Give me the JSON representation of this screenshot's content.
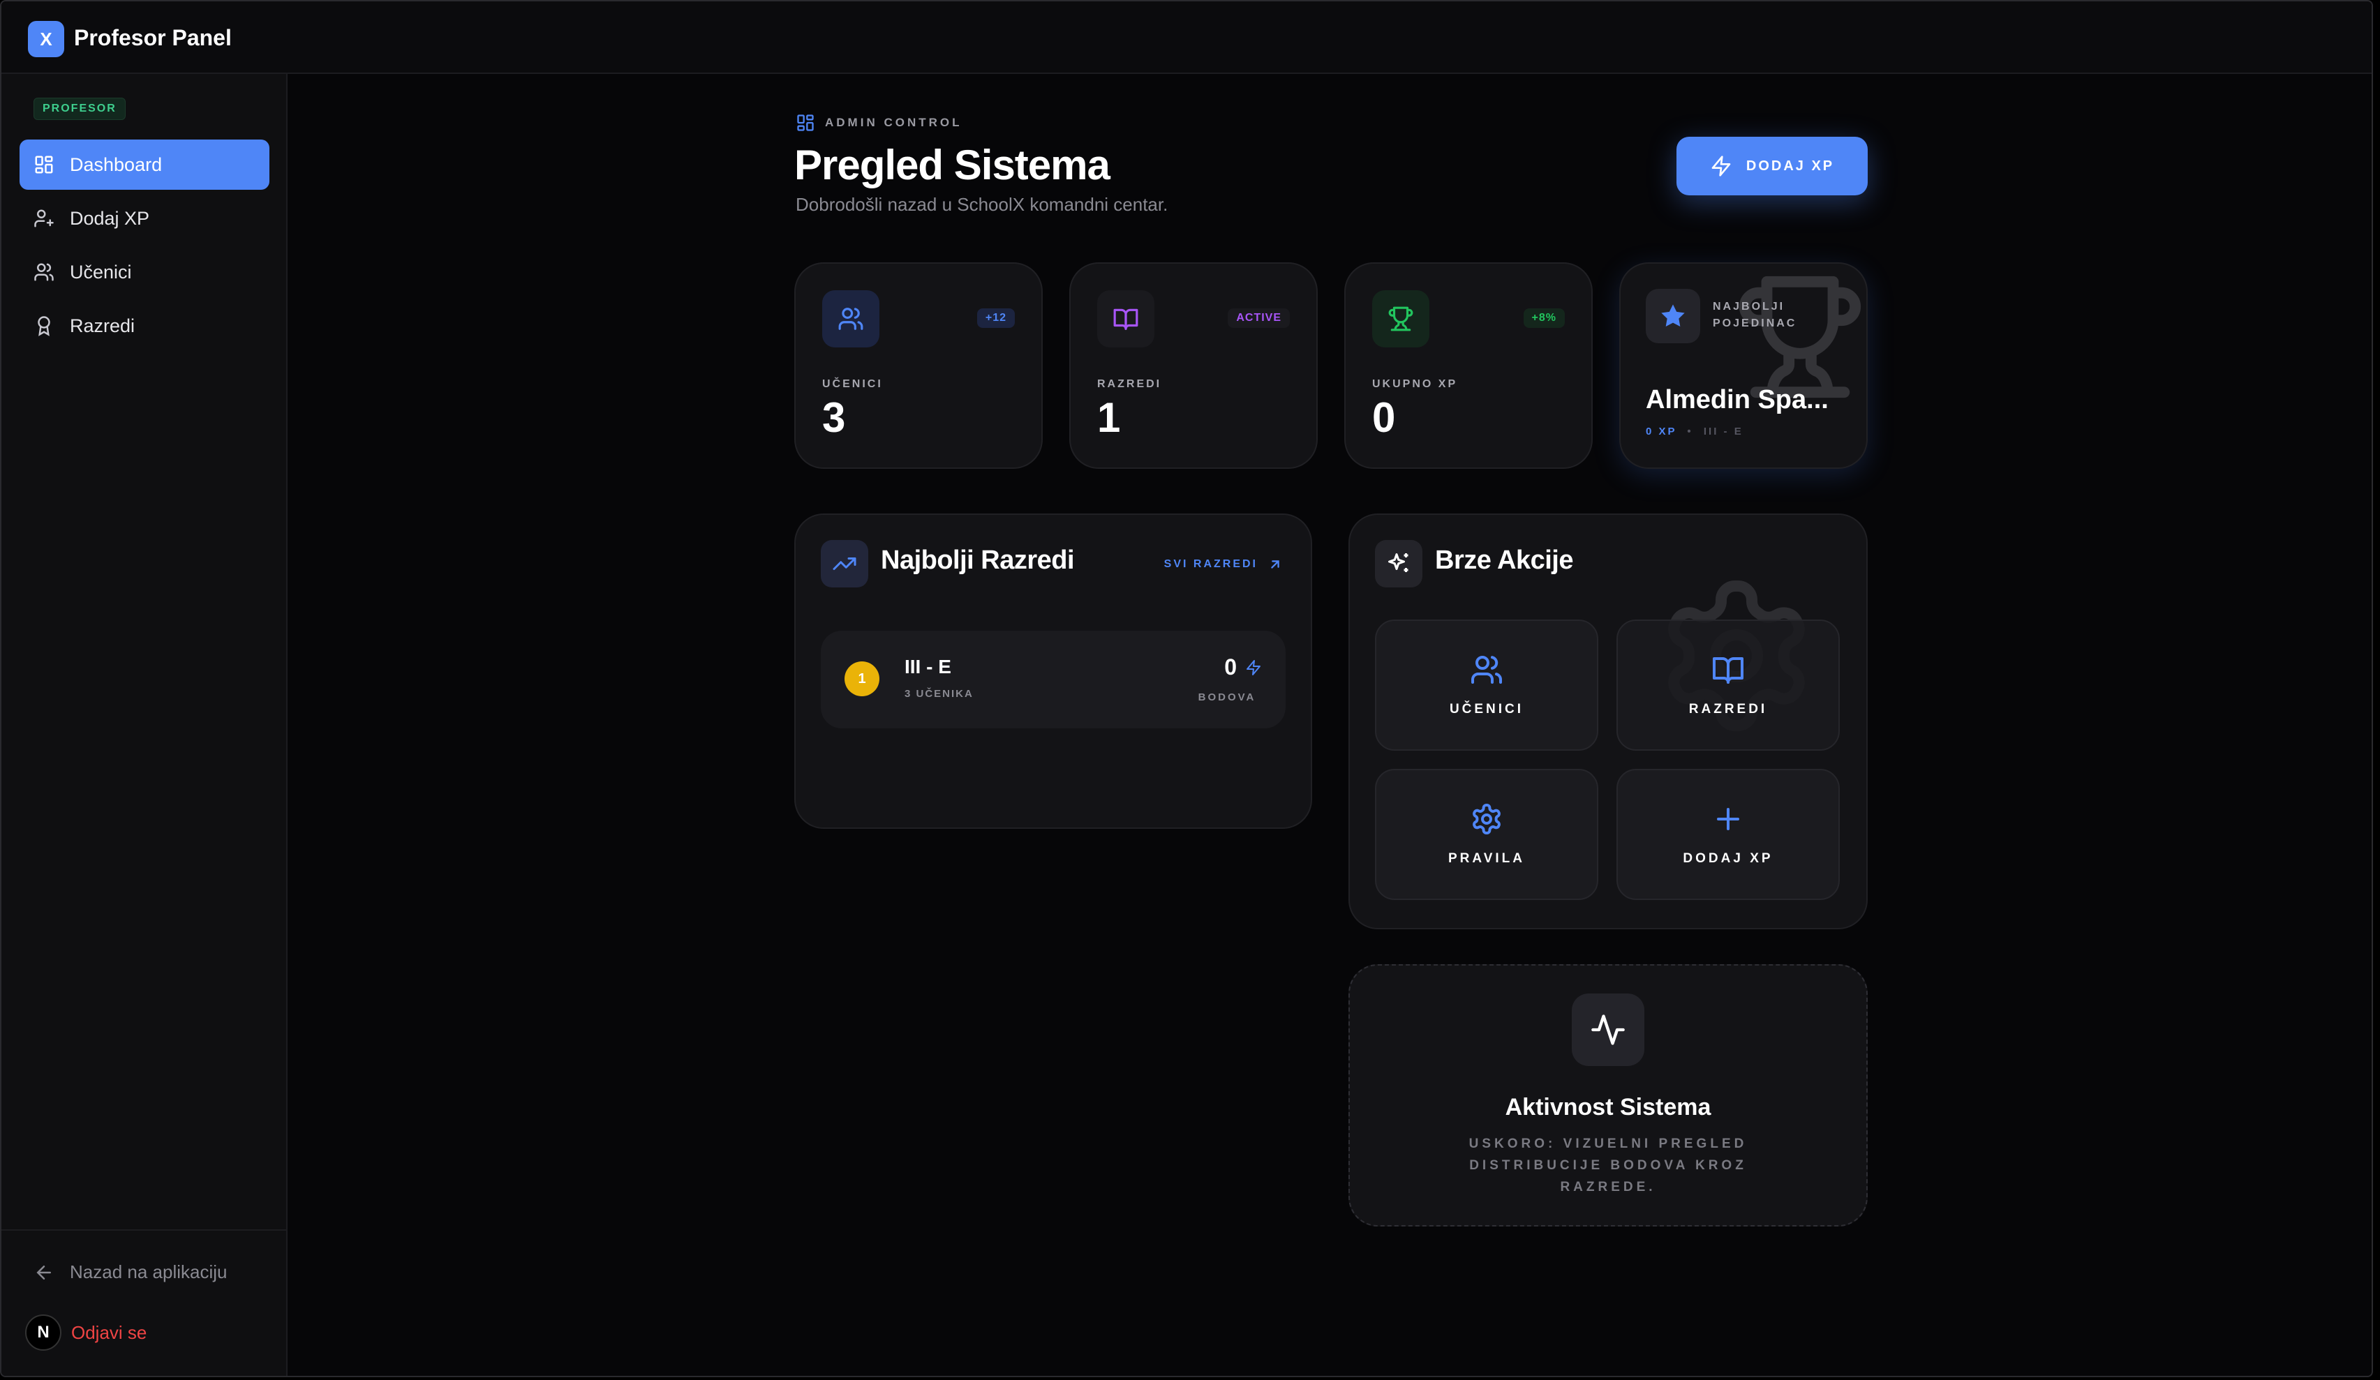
{
  "app": {
    "logo_letter": "X",
    "title": "Profesor Panel"
  },
  "sidebar": {
    "role": "PROFESOR",
    "items": [
      {
        "label": "Dashboard",
        "icon": "dashboard-icon",
        "active": true
      },
      {
        "label": "Dodaj XP",
        "icon": "user-plus-icon",
        "active": false
      },
      {
        "label": "Učenici",
        "icon": "users-icon",
        "active": false
      },
      {
        "label": "Razredi",
        "icon": "award-icon",
        "active": false
      }
    ],
    "back_label": "Nazad na aplikaciju",
    "avatar_letter": "N",
    "logout_label": "Odjavi se"
  },
  "header": {
    "eyebrow": "ADMIN CONTROL",
    "title": "Pregled Sistema",
    "subtitle": "Dobrodošli nazad u SchoolX komandni centar.",
    "cta_label": "DODAJ XP"
  },
  "stats": [
    {
      "label": "UČENICI",
      "value": "3",
      "badge": "+12",
      "icon": "users-icon",
      "color": "#4f86f7"
    },
    {
      "label": "RAZREDI",
      "value": "1",
      "badge": "ACTIVE",
      "icon": "book-icon",
      "color": "#a855f7"
    },
    {
      "label": "UKUPNO XP",
      "value": "0",
      "badge": "+8%",
      "icon": "trophy-icon",
      "color": "#22c55e"
    }
  ],
  "top_student": {
    "tag": "NAJBOLJI POJEDINAC",
    "name": "Almedin Spa...",
    "xp": "0 XP",
    "separator": "•",
    "class": "III - E"
  },
  "best_classes": {
    "title": "Najbolji Razredi",
    "link_label": "SVI RAZREDI",
    "rows": [
      {
        "rank": "1",
        "name": "III - E",
        "students": "3 UČENIKA",
        "points": "0",
        "points_label": "BODOVA"
      }
    ]
  },
  "quick_actions": {
    "title": "Brze Akcije",
    "items": [
      {
        "label": "UČENICI",
        "icon": "users-icon"
      },
      {
        "label": "RAZREDI",
        "icon": "book-icon"
      },
      {
        "label": "PRAVILA",
        "icon": "gear-icon"
      },
      {
        "label": "DODAJ XP",
        "icon": "plus-icon"
      }
    ]
  },
  "activity": {
    "title": "Aktivnost Sistema",
    "description": "USKORO: VIZUELNI PREGLED DISTRIBUCIJE BODOVA KROZ RAZREDE."
  },
  "colors": {
    "accent": "#4f86f7",
    "purple": "#a855f7",
    "green": "#22c55e",
    "gold": "#eab308",
    "danger": "#ef4444",
    "background": "#060608",
    "card": "#131316"
  }
}
